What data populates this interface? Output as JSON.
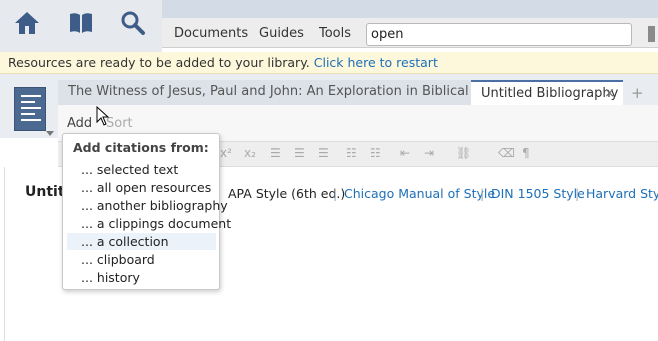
{
  "topbar": {
    "nav_icons": [
      "home-icon",
      "library-icon",
      "search-icon"
    ],
    "menu": [
      "Documents",
      "Guides",
      "Tools"
    ],
    "search_value": "open"
  },
  "notification": {
    "text": "Resources are ready to be added to your library. ",
    "link": "Click here to restart"
  },
  "tabs": [
    {
      "label": "The Witness of Jesus, Paul and John: An Exploration in Biblical Theology"
    },
    {
      "label": "Untitled Bibliography",
      "close": "×"
    }
  ],
  "tab_add": "+",
  "subbar": {
    "add": "Add",
    "sort": "Sort"
  },
  "document": {
    "title": "Untitl",
    "styles": [
      "APA Style (6th ed.)",
      "Chicago Manual of Style",
      "DIN 1505 Style",
      "Harvard Style"
    ],
    "separator": "|"
  },
  "popup": {
    "heading": "Add citations from:",
    "items": [
      "... selected text",
      "... all open resources",
      "... another bibliography",
      "... a clippings document",
      "... a collection",
      "... clipboard",
      "... history"
    ],
    "highlighted_index": 4
  },
  "toolbar_icons": [
    "superscript-icon",
    "subscript-icon",
    "align-left-icon",
    "align-center-icon",
    "align-right-icon",
    "bullet-list-icon",
    "numbered-list-icon",
    "outdent-icon",
    "indent-icon",
    "link-icon",
    "eraser-icon",
    "paragraph-icon"
  ],
  "colors": {
    "accent": "#4a6fa5",
    "link": "#1e6fb8",
    "notify_bg": "#fdf8dc"
  }
}
